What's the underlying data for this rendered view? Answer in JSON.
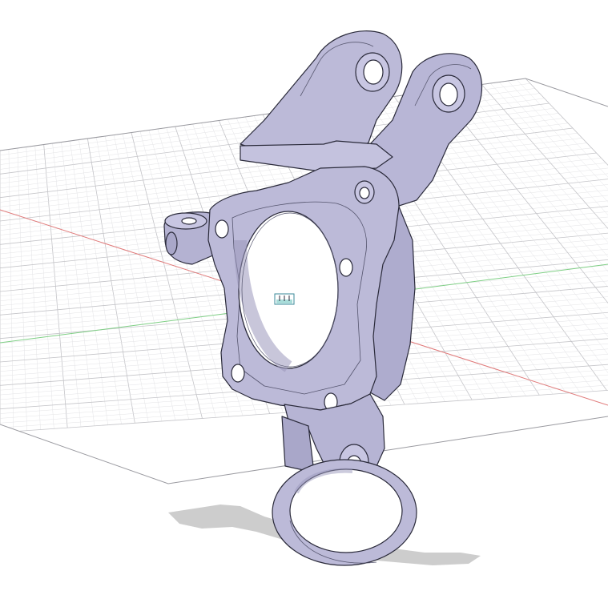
{
  "viewport": {
    "background": "#ffffff",
    "grid_minor_color": "#e3e3e6",
    "grid_major_color": "#c4c4c8",
    "x_axis_color": "#e07a7a",
    "y_axis_color": "#7fcf85",
    "part_fill": "#bcbad8",
    "part_edge": "#2a2a3a",
    "shadow_color": "#c8c8c8",
    "grid_labels": [
      "",
      "",
      "",
      "",
      "",
      ""
    ]
  },
  "icons": {
    "origin": "origin-marker-icon"
  }
}
